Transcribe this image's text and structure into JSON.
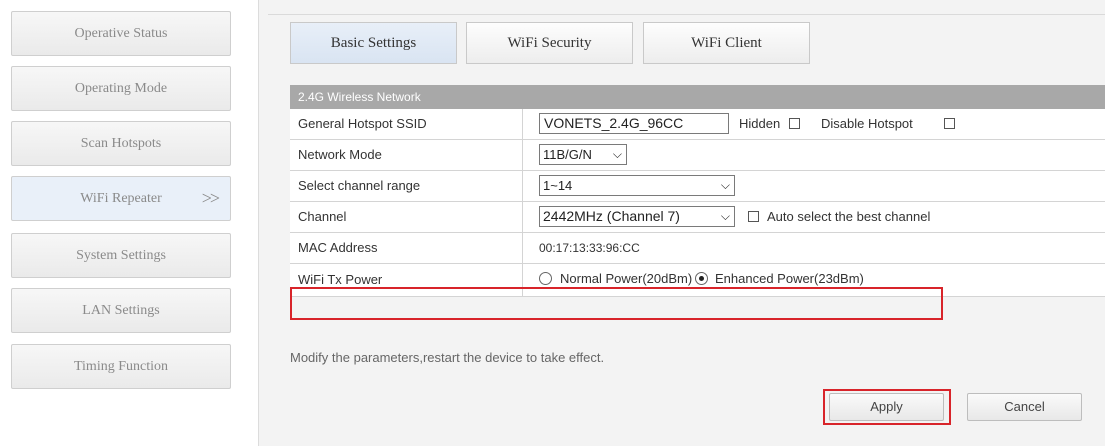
{
  "sidebar": {
    "items": [
      {
        "label": "Operative Status"
      },
      {
        "label": "Operating Mode"
      },
      {
        "label": "Scan Hotspots"
      },
      {
        "label": "WiFi Repeater",
        "active": true,
        "chevron": ">>"
      },
      {
        "label": "System Settings"
      },
      {
        "label": "LAN Settings"
      },
      {
        "label": "Timing Function"
      }
    ]
  },
  "tabs": [
    {
      "label": "Basic Settings",
      "active": true
    },
    {
      "label": "WiFi Security"
    },
    {
      "label": "WiFi Client"
    }
  ],
  "section": {
    "title": "2.4G Wireless Network"
  },
  "rows": {
    "ssid": {
      "label": "General Hotspot SSID",
      "value": "VONETS_2.4G_96CC",
      "hidden_label": "Hidden",
      "disable_label": "Disable Hotspot"
    },
    "mode": {
      "label": "Network Mode",
      "value": "11B/G/N"
    },
    "range": {
      "label": "Select channel range",
      "value": "1~14"
    },
    "channel": {
      "label": "Channel",
      "value": "2442MHz (Channel 7)",
      "auto_label": "Auto select the best channel"
    },
    "mac": {
      "label": "MAC Address",
      "value": "00:17:13:33:96:CC"
    },
    "power": {
      "label": "WiFi Tx Power",
      "normal_label": "Normal Power(20dBm)",
      "enhanced_label": "Enhanced Power(23dBm)",
      "selected": "enhanced"
    }
  },
  "note": "Modify the parameters,restart the device to take effect.",
  "buttons": {
    "apply": "Apply",
    "cancel": "Cancel"
  },
  "colors": {
    "highlight": "#d8242a",
    "header": "#a8a8a8",
    "active_tab": "#e8eff8"
  }
}
